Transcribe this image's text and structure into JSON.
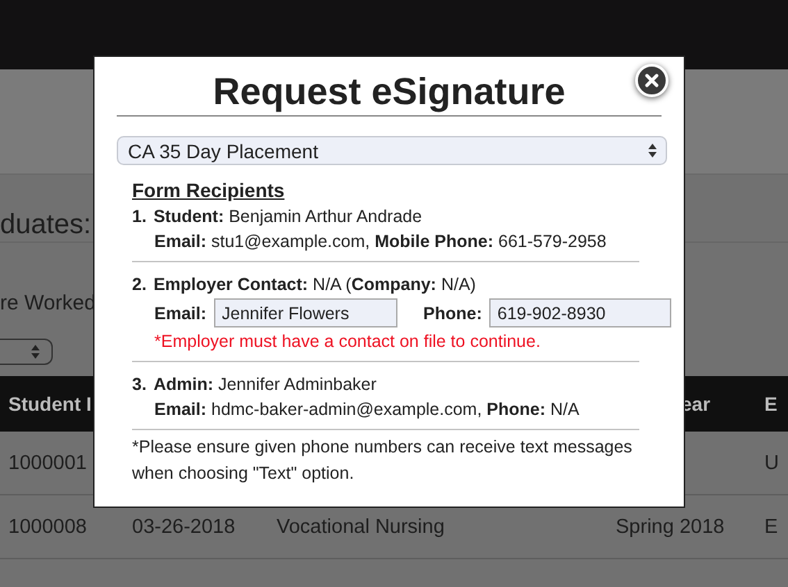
{
  "background_page": {
    "heading": "duates:",
    "filter_label": "re Worked",
    "table": {
      "header": {
        "column_1": "Student I",
        "column_4": "ear",
        "column_5": "E"
      },
      "rows": [
        {
          "column_1": "1000001",
          "column_5": "U"
        },
        {
          "column_1": "1000008",
          "column_2": "03-26-2018",
          "column_3": "Vocational Nursing",
          "column_4": "Spring 2018",
          "column_5": "E"
        }
      ]
    }
  },
  "dialog": {
    "title": "Request eSignature",
    "form_select": {
      "value": "CA 35 Day Placement"
    },
    "section_title": "Form Recipients",
    "recipients": [
      {
        "number": "1.",
        "heading": "**Student:** Benjamin Arthur Andrade",
        "details": [
          {
            "kind": "text",
            "text": "**Email:** stu1@example.com, **Mobile Phone:** 661-579-2958"
          }
        ]
      },
      {
        "number": "2.",
        "heading": "**Employer Contact:** N/A (**Company:** N/A)",
        "details": [
          {
            "kind": "fields",
            "fields": [
              {
                "label": "Email:",
                "value": "Jennifer Flowers"
              },
              {
                "label": "Phone:",
                "value": "619-902-8930"
              }
            ]
          },
          {
            "kind": "error",
            "text": "*Employer must have a contact on file to continue."
          }
        ]
      },
      {
        "number": "3.",
        "heading": "**Admin:** Jennifer Adminbaker",
        "details": [
          {
            "kind": "text",
            "text": "**Email:** hdmc-baker-admin@example.com, **Phone:** N/A"
          }
        ]
      }
    ],
    "note": "*Please ensure given phone numbers can receive text messages when choosing \"Text\" option."
  }
}
